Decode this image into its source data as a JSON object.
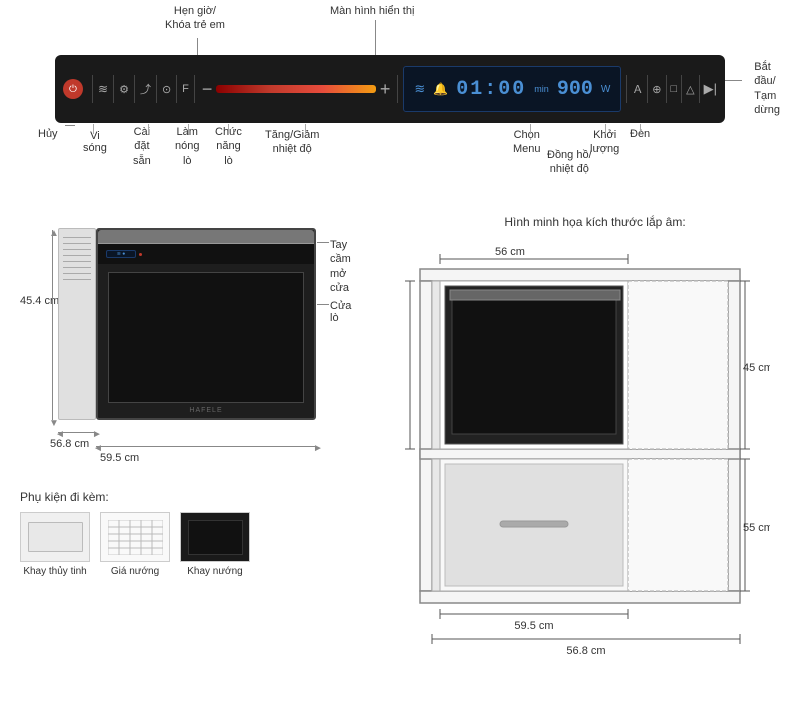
{
  "annotations": {
    "hen_gio": "Hẹn giờ/\nKhóa trẻ em",
    "man_hinh": "Màn hình hiển thị",
    "huy": "Hủy",
    "vi_song": "Vi\nsóng",
    "cai_dat": "Cài\nđặt\nsẵn",
    "lam_nong": "Làm\nnóng\nlò",
    "chuc_nang": "Chức\nnăng\nlò",
    "tang_giam": "Tăng/Giảm\nnhiệt độ",
    "chon_menu": "Chọn\nMenu",
    "dong_ho": "Đồng hồ/\nnhiệt độ",
    "khoi_luong": "Khởi\nlượng",
    "den": "Đèn",
    "bat_dau": "Bắt\nđầu/\nTạm\ndừng"
  },
  "display": {
    "time": "01:00",
    "time_unit": "min",
    "temp": "900",
    "temp_unit": "W"
  },
  "dimensions": {
    "height": "45.4 cm",
    "width_front": "56.8 cm",
    "depth": "59.5 cm",
    "cabinet_width": "56 cm",
    "cabinet_height": "45 cm",
    "cabinet_depth": "55 cm",
    "install_width": "59.5 cm",
    "install_depth": "56.8 cm",
    "install_title": "Hình minh họa kích thước lắp âm:"
  },
  "oven": {
    "handle_label": "Tay cầm\nmở cửa",
    "door_label": "Cửa lò",
    "brand": "HAFELE"
  },
  "accessories": {
    "title": "Phụ kiện đi kèm:",
    "items": [
      {
        "label": "Khay thủy tinh"
      },
      {
        "label": "Giá nướng"
      },
      {
        "label": "Khay nướng"
      }
    ]
  }
}
